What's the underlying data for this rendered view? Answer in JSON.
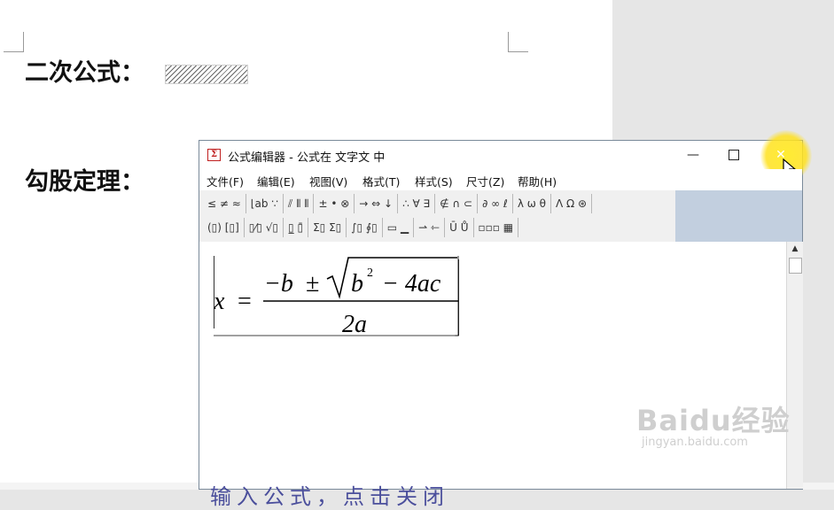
{
  "document": {
    "heading1": "二次公式：",
    "heading2": "勾股定理："
  },
  "window": {
    "icon_glyph": "Σ",
    "title": "公式编辑器 - 公式在 文字文 中",
    "controls": {
      "minimize": "—",
      "maximize": "",
      "close": "✕"
    }
  },
  "menu": [
    "文件(F)",
    "编辑(E)",
    "视图(V)",
    "格式(T)",
    "样式(S)",
    "尺寸(Z)",
    "帮助(H)"
  ],
  "toolbar": {
    "row1": [
      "≤ ≠ ≈",
      "⌊ab ∵",
      "⫽ ⦀ ⦀",
      "± • ⊗",
      "→ ⇔ ↓",
      "∴ ∀ ∃",
      "∉ ∩ ⊂",
      "∂ ∞ ℓ",
      "λ ω θ",
      "Λ Ω ⊛"
    ],
    "row2": [
      "(▯) [▯]",
      "▯⁄▯ √▯",
      "▯̲ ▯̄",
      "Σ▯ Σ▯",
      "∫▯ ∮▯",
      "▭ ▁",
      "⇀ ⇽",
      "Ū Ů",
      "▫▫▫ ▦"
    ]
  },
  "formula": {
    "lhs": "x",
    "equals": "=",
    "minus_b": "−b",
    "plus_minus": "±",
    "radicand_b": "b",
    "exponent": "2",
    "minus_4ac": "− 4ac",
    "denominator": "2a"
  },
  "watermark": {
    "logo": "Baidu经验",
    "url": "jingyan.baidu.com"
  },
  "bottom_text": "输入公式，点击关闭"
}
